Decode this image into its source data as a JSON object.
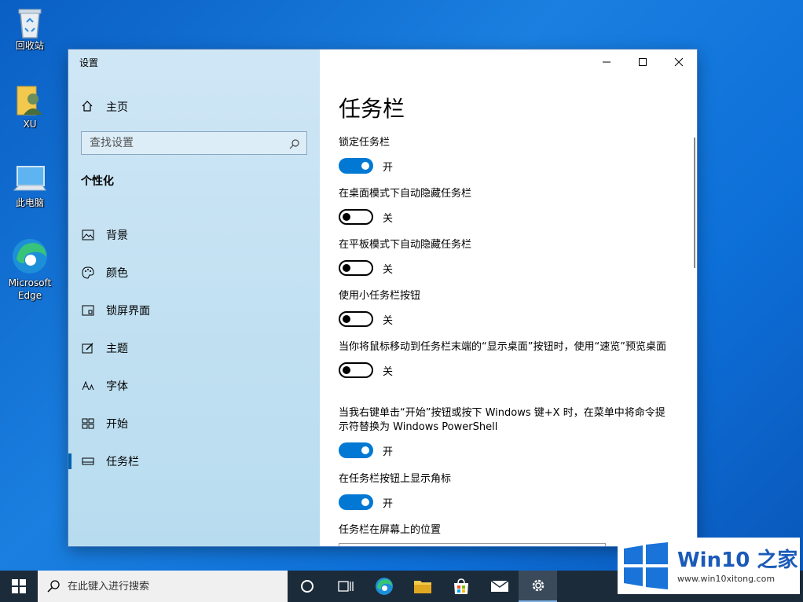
{
  "desktop": {
    "icons": [
      {
        "label": "回收站"
      },
      {
        "label": "XU"
      },
      {
        "label": "此电脑"
      },
      {
        "label": "Microsoft Edge"
      }
    ]
  },
  "settings": {
    "app_title": "设置",
    "home_label": "主页",
    "search_placeholder": "查找设置",
    "section_title": "个性化",
    "nav": [
      {
        "label": "背景",
        "icon": "picture-icon"
      },
      {
        "label": "颜色",
        "icon": "palette-icon"
      },
      {
        "label": "锁屏界面",
        "icon": "lockscreen-icon"
      },
      {
        "label": "主题",
        "icon": "theme-icon"
      },
      {
        "label": "字体",
        "icon": "font-icon"
      },
      {
        "label": "开始",
        "icon": "start-icon"
      },
      {
        "label": "任务栏",
        "icon": "taskbar-icon",
        "active": true
      }
    ],
    "page_title": "任务栏",
    "settings_list": [
      {
        "label": "锁定任务栏",
        "on": true,
        "state": "开"
      },
      {
        "label": "在桌面模式下自动隐藏任务栏",
        "on": false,
        "state": "关"
      },
      {
        "label": "在平板模式下自动隐藏任务栏",
        "on": false,
        "state": "关"
      },
      {
        "label": "使用小任务栏按钮",
        "on": false,
        "state": "关"
      },
      {
        "label": "当你将鼠标移动到任务栏末端的“显示桌面”按钮时，使用“速览”预览桌面",
        "on": false,
        "state": "关"
      },
      {
        "label": "当我右键单击“开始”按钮或按下 Windows 键+X 时，在菜单中将命令提示符替换为 Windows PowerShell",
        "on": true,
        "state": "开"
      },
      {
        "label": "在任务栏按钮上显示角标",
        "on": true,
        "state": "开"
      }
    ],
    "position_label": "任务栏在屏幕上的位置"
  },
  "taskbar": {
    "search_placeholder": "在此键入进行搜索"
  },
  "watermark": {
    "brand_a": "Win10",
    "brand_b": " 之家",
    "url": "www.win10xitong.com"
  },
  "colors": {
    "accent": "#0078d4",
    "sidebar": "#c2e1f2",
    "taskbar": "#1c2b3a"
  }
}
